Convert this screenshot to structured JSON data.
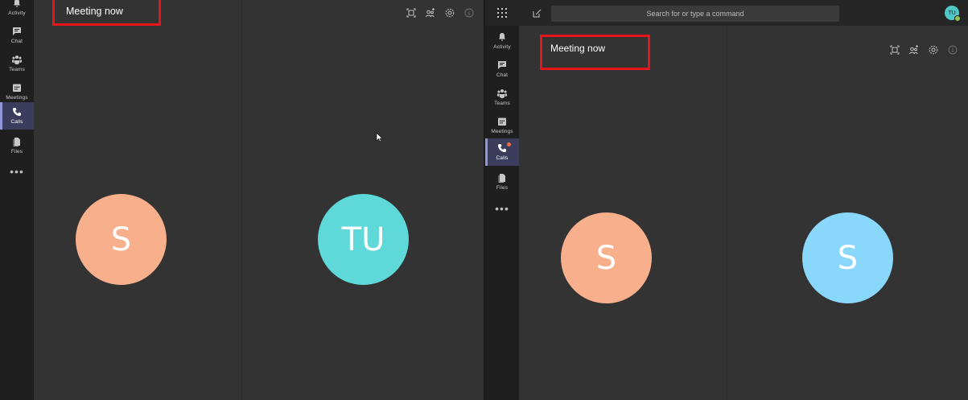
{
  "nav_items": {
    "activity": "Activity",
    "chat": "Chat",
    "teams": "Teams",
    "meetings": "Meetings",
    "calls": "Calls",
    "files": "Files",
    "more": "•••"
  },
  "left_window": {
    "meeting_title": "Meeting now",
    "participants": [
      {
        "initials": "S",
        "color": "#f8b08c"
      },
      {
        "initials": "TU",
        "color": "#5ed8d8"
      }
    ]
  },
  "right_window": {
    "meeting_title": "Meeting now",
    "search_placeholder": "Search for or type a command",
    "me_initials": "TU",
    "participants": [
      {
        "initials": "S",
        "color": "#f8b08c"
      },
      {
        "initials": "S",
        "color": "#89d7fb"
      }
    ]
  },
  "icons": [
    "activity-icon",
    "chat-icon",
    "teams-icon",
    "meetings-icon",
    "calls-icon",
    "files-icon",
    "fullscreen-icon",
    "add-people-icon",
    "settings-icon",
    "info-icon",
    "apps-grid-icon",
    "compose-icon"
  ],
  "colors": {
    "highlight_box": "#e5151b",
    "active_nav": "#3c3d5d",
    "accent": "#8f95d6"
  }
}
